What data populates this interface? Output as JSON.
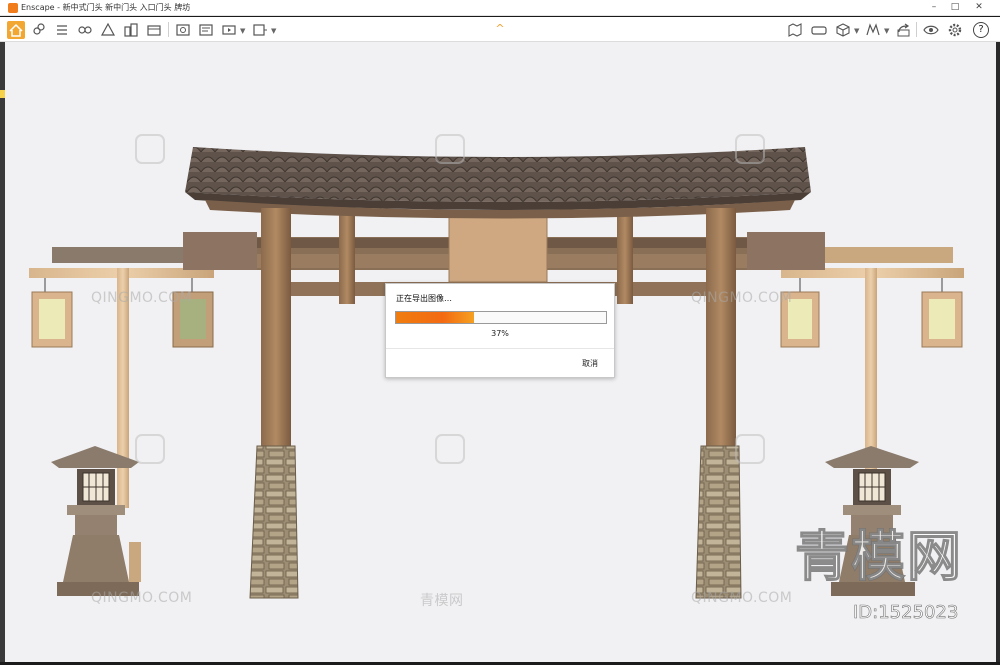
{
  "window": {
    "app_name": "Enscape",
    "title": "Enscape - 新中式门头 新中门头 入口门头 牌坊",
    "minimize": "–",
    "maximize": "□",
    "close": "✕"
  },
  "toolbar": {
    "left_icons": [
      "home-icon",
      "link-icon",
      "list-icon",
      "views-icon",
      "asset-library-icon",
      "buildings-icon",
      "material-editor-icon",
      "screenshot-icon",
      "batch-render-icon",
      "video-export-icon",
      "panorama-icon"
    ],
    "right_icons": [
      "map-icon",
      "vr-icon",
      "cube-icon",
      "materials-icon",
      "share-icon",
      "eye-settings-icon",
      "gear-icon"
    ],
    "help_label": "?"
  },
  "collapse_icon": "chevron-up-icon",
  "export_dialog": {
    "title": "正在导出图像…",
    "progress_percent": 37,
    "progress_label": "37%",
    "cancel_label": "取消"
  },
  "watermarks": {
    "site_text": "QINGMO.COM",
    "site_text_cn": "青模网",
    "big_text": "青模网",
    "id_text": "ID:1525023"
  },
  "colors": {
    "accent": "#f3a733",
    "progress": "#f36a12",
    "viewport_bg": "#f1f1f3"
  }
}
